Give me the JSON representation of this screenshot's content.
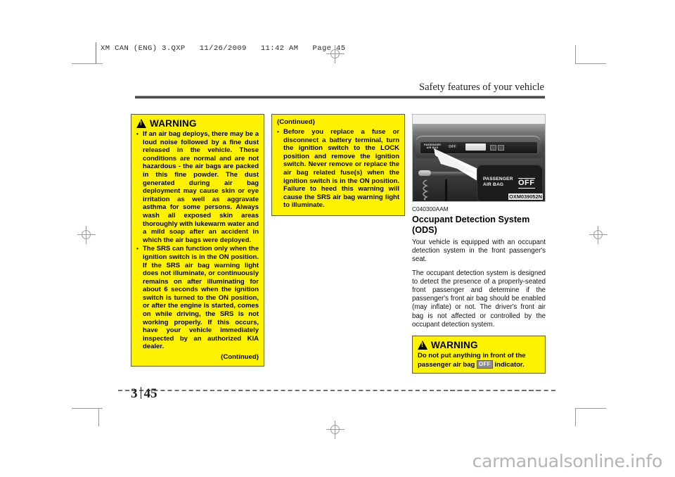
{
  "prepress": {
    "slug": "XM CAN (ENG) 3.QXP   11/26/2009   11:42 AM   Page 45"
  },
  "running_head": {
    "title": "Safety features of your vehicle"
  },
  "warning_left": {
    "title": "WARNING",
    "items": [
      "If an air bag deploys, there may be a loud noise followed by a fine dust released in the vehicle. These conditions are normal and are not hazardous - the air bags are packed in this fine powder. The dust generated during air bag deployment may cause skin or eye irritation as well as aggravate asthma for some persons. Always wash all exposed skin areas thoroughly with lukewarm water and a mild soap after an accident in which the air bags were deployed.",
      "The SRS can function only when the ignition switch is in the ON position. If the SRS air bag warning light does not illuminate, or continuously remains on after illuminating for about 6 seconds when the ignition switch is turned to the ON position, or after the engine is started, comes on while driving, the SRS is not working properly. If this occurs, have your vehicle immediately inspected by an authorized KIA dealer."
    ],
    "continued_label": "(Continued)"
  },
  "warning_middle": {
    "continued_top": "(Continued)",
    "items": [
      "Before you replace a fuse or disconnect a battery terminal, turn the ignition switch to the LOCK position and remove the ignition switch. Never remove or replace the air bag related fuse(s) when the ignition switch is in the ON position. Failure to heed this warning will cause the SRS air bag warning light to illuminate."
    ]
  },
  "figure": {
    "id": "OXM039052N",
    "caption": "",
    "dashboard_label_line1": "PASSENGER",
    "dashboard_label_line2": "AIR BAG",
    "dashboard_small_off": "OFF",
    "callout_line1": "PASSENGER",
    "callout_line2": "AIR BAG",
    "callout_off": "OFF"
  },
  "section": {
    "code": "C040300AAM",
    "title_line1": "Occupant Detection System",
    "title_line2": "(ODS)",
    "paragraphs": [
      "Your vehicle is equipped with an occupant detection system in the front passenger's seat.",
      "The occupant detection system is designed to detect the presence of a properly-seated front passenger and determine if the passenger's front air bag should be enabled (may inflate) or not. The driver's front air bag is not affected or controlled by the occupant detection system."
    ]
  },
  "warning_right": {
    "title": "WARNING",
    "text_before_chip": "Do not put anything in front of the passenger air bag",
    "chip_label": "OFF",
    "text_after_chip": "indicator."
  },
  "footer": {
    "chapter": "3",
    "page": "45"
  },
  "watermark": {
    "text": "carmanualsonline.info"
  }
}
